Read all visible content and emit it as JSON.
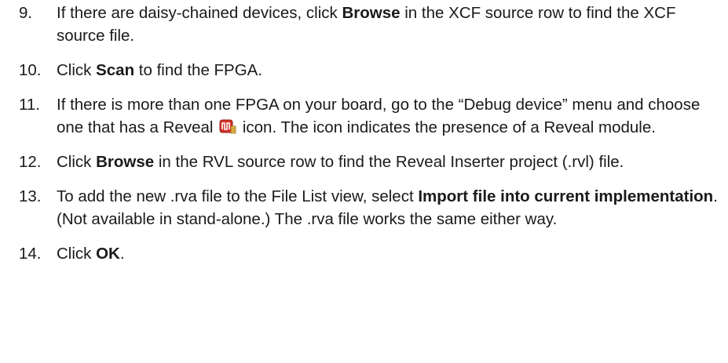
{
  "steps": [
    {
      "number": "9.",
      "parts": [
        {
          "t": "If there are daisy-chained devices, click "
        },
        {
          "t": "Browse",
          "b": true
        },
        {
          "t": " in the XCF source row to find the XCF source file."
        }
      ]
    },
    {
      "number": "10.",
      "parts": [
        {
          "t": "Click "
        },
        {
          "t": "Scan",
          "b": true
        },
        {
          "t": " to find the FPGA."
        }
      ]
    },
    {
      "number": "11.",
      "parts": [
        {
          "t": "If there is more than one FPGA on your board, go to the “Debug device” menu and choose one that has a Reveal "
        },
        {
          "icon": "reveal-icon"
        },
        {
          "t": " icon. The icon indicates the presence of a Reveal module."
        }
      ]
    },
    {
      "number": "12.",
      "parts": [
        {
          "t": "Click "
        },
        {
          "t": "Browse",
          "b": true
        },
        {
          "t": " in the RVL source row to find the Reveal Inserter project (.rvl) file."
        }
      ]
    },
    {
      "number": "13.",
      "parts": [
        {
          "t": "To add the new .rva file to the File List view, select "
        },
        {
          "t": "Import file into current implementation",
          "b": true
        },
        {
          "t": ". (Not available in stand-alone.) The .rva file works the same either way."
        }
      ]
    },
    {
      "number": "14.",
      "parts": [
        {
          "t": "Click "
        },
        {
          "t": "OK",
          "b": true
        },
        {
          "t": "."
        }
      ]
    }
  ],
  "colors": {
    "text": "#1a1a1a",
    "icon_red": "#d9342b",
    "icon_gold": "#e8b64a"
  }
}
